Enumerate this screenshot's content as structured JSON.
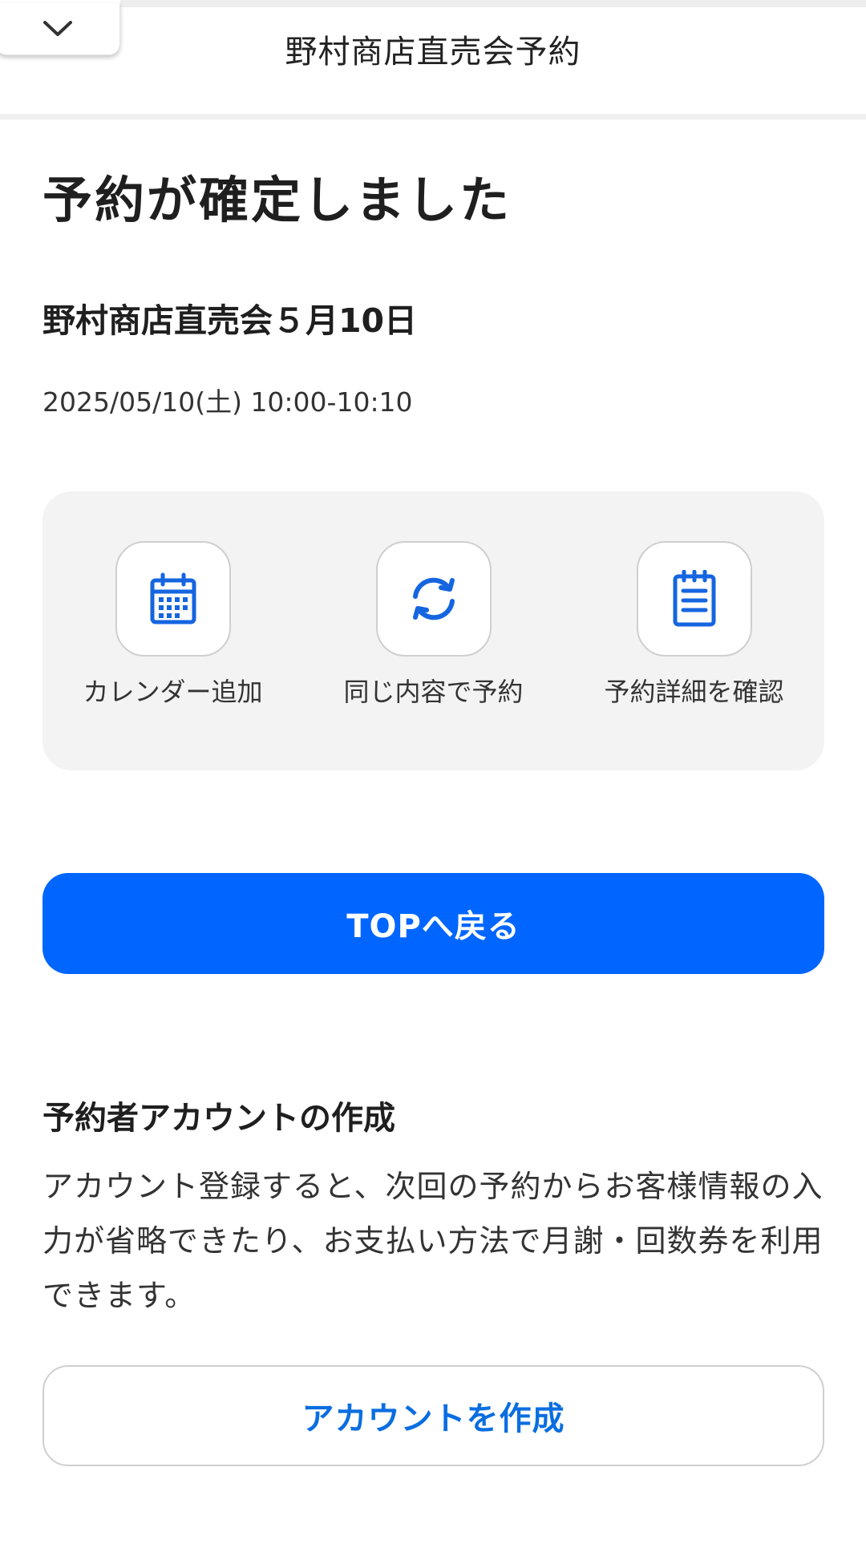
{
  "header": {
    "title": "野村商店直売会予約",
    "collapse_icon": "chevron-down-icon"
  },
  "confirmation": {
    "title": "予約が確定しました",
    "event_name": "野村商店直売会５月10日",
    "datetime": "2025/05/10(土) 10:00-10:10"
  },
  "actions": [
    {
      "label": "カレンダー追加",
      "icon": "calendar-icon"
    },
    {
      "label": "同じ内容で予約",
      "icon": "refresh-icon"
    },
    {
      "label": "予約詳細を確認",
      "icon": "notepad-icon"
    }
  ],
  "top_button": {
    "label": "TOPへ戻る"
  },
  "account": {
    "heading": "予約者アカウントの作成",
    "description": "アカウント登録すると、次回の予約からお客様情報の入力が省略できたり、お支払い方法で月謝・回数券を利用できます。",
    "button_label": "アカウントを作成"
  },
  "colors": {
    "primary": "#0066ff",
    "link": "#0a6ee0",
    "panel_bg": "#f3f3f3",
    "icon": "#1565e0"
  }
}
